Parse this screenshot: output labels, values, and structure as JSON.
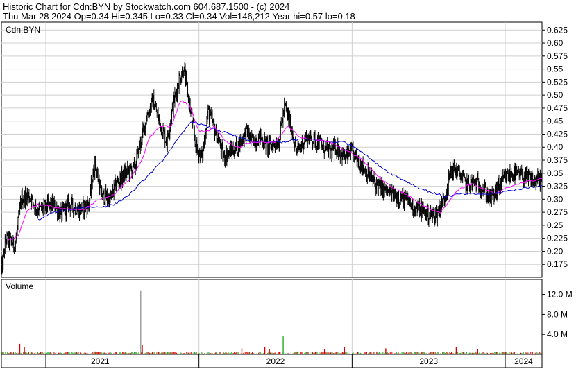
{
  "header": {
    "line1": "Historic Chart for Cdn:BYN by Stockwatch.com 604.687.1500 - (c) 2024",
    "line2": "Thu Mar 28 2024  Op=0.34  Hi=0.345  Lo=0.33  Cl=0.34  Vol=146,212  Year hi=0.57  lo=0.18"
  },
  "colors": {
    "price": "#000000",
    "ma_short": "#ff00ff",
    "ma_long": "#0000cc",
    "vol_up": "#22aa22",
    "vol_down": "#dd0000",
    "vol_spike": "#999999",
    "grid": "#cfcfcf",
    "frame": "#000000"
  },
  "chart_data": [
    {
      "type": "line",
      "name": "price",
      "panel_label": "Cdn:BYN",
      "grid": true,
      "y_axis_side": "right",
      "ylim": [
        0.15,
        0.64
      ],
      "y_ticks": [
        "0.625",
        "0.60",
        "0.575",
        "0.55",
        "0.525",
        "0.50",
        "0.475",
        "0.45",
        "0.425",
        "0.40",
        "0.375",
        "0.35",
        "0.325",
        "0.30",
        "0.275",
        "0.25",
        "0.225",
        "0.20",
        "0.175"
      ],
      "x_labels": [
        "2021",
        "2022",
        "2023",
        "2024"
      ],
      "xlim": [
        2020.71,
        2024.24
      ],
      "year_boundaries": [
        2021.0,
        2022.0,
        2023.0,
        2024.0
      ],
      "price_anchors": [
        [
          2020.71,
          0.16
        ],
        [
          2020.74,
          0.225
        ],
        [
          2020.8,
          0.21
        ],
        [
          2020.84,
          0.3
        ],
        [
          2020.88,
          0.31
        ],
        [
          2020.95,
          0.28
        ],
        [
          2021.05,
          0.29
        ],
        [
          2021.1,
          0.27
        ],
        [
          2021.15,
          0.29
        ],
        [
          2021.22,
          0.28
        ],
        [
          2021.28,
          0.29
        ],
        [
          2021.32,
          0.37
        ],
        [
          2021.36,
          0.31
        ],
        [
          2021.42,
          0.3
        ],
        [
          2021.46,
          0.33
        ],
        [
          2021.52,
          0.35
        ],
        [
          2021.58,
          0.36
        ],
        [
          2021.62,
          0.41
        ],
        [
          2021.66,
          0.46
        ],
        [
          2021.7,
          0.49
        ],
        [
          2021.74,
          0.45
        ],
        [
          2021.79,
          0.41
        ],
        [
          2021.83,
          0.48
        ],
        [
          2021.87,
          0.53
        ],
        [
          2021.9,
          0.55
        ],
        [
          2021.94,
          0.48
        ],
        [
          2021.98,
          0.4
        ],
        [
          2022.02,
          0.38
        ],
        [
          2022.06,
          0.47
        ],
        [
          2022.12,
          0.42
        ],
        [
          2022.16,
          0.38
        ],
        [
          2022.2,
          0.39
        ],
        [
          2022.25,
          0.4
        ],
        [
          2022.31,
          0.43
        ],
        [
          2022.35,
          0.41
        ],
        [
          2022.4,
          0.42
        ],
        [
          2022.45,
          0.4
        ],
        [
          2022.52,
          0.41
        ],
        [
          2022.56,
          0.48
        ],
        [
          2022.6,
          0.44
        ],
        [
          2022.64,
          0.39
        ],
        [
          2022.7,
          0.42
        ],
        [
          2022.78,
          0.41
        ],
        [
          2022.85,
          0.39
        ],
        [
          2022.9,
          0.4
        ],
        [
          2022.95,
          0.38
        ],
        [
          2023.0,
          0.39
        ],
        [
          2023.05,
          0.37
        ],
        [
          2023.1,
          0.35
        ],
        [
          2023.15,
          0.33
        ],
        [
          2023.2,
          0.32
        ],
        [
          2023.25,
          0.31
        ],
        [
          2023.3,
          0.305
        ],
        [
          2023.35,
          0.3
        ],
        [
          2023.4,
          0.285
        ],
        [
          2023.45,
          0.28
        ],
        [
          2023.5,
          0.27
        ],
        [
          2023.55,
          0.27
        ],
        [
          2023.6,
          0.3
        ],
        [
          2023.65,
          0.36
        ],
        [
          2023.7,
          0.35
        ],
        [
          2023.74,
          0.33
        ],
        [
          2023.78,
          0.33
        ],
        [
          2023.82,
          0.33
        ],
        [
          2023.86,
          0.32
        ],
        [
          2023.9,
          0.3
        ],
        [
          2023.93,
          0.31
        ],
        [
          2023.97,
          0.33
        ],
        [
          2024.0,
          0.34
        ],
        [
          2024.05,
          0.35
        ],
        [
          2024.1,
          0.345
        ],
        [
          2024.15,
          0.34
        ],
        [
          2024.2,
          0.335
        ],
        [
          2024.24,
          0.34
        ]
      ],
      "ma_short_anchors": [
        [
          2020.75,
          0.22
        ],
        [
          2020.82,
          0.23
        ],
        [
          2020.88,
          0.28
        ],
        [
          2020.95,
          0.29
        ],
        [
          2021.05,
          0.285
        ],
        [
          2021.15,
          0.28
        ],
        [
          2021.25,
          0.28
        ],
        [
          2021.35,
          0.3
        ],
        [
          2021.45,
          0.31
        ],
        [
          2021.55,
          0.34
        ],
        [
          2021.62,
          0.37
        ],
        [
          2021.68,
          0.42
        ],
        [
          2021.75,
          0.44
        ],
        [
          2021.82,
          0.44
        ],
        [
          2021.88,
          0.49
        ],
        [
          2021.94,
          0.48
        ],
        [
          2022.0,
          0.43
        ],
        [
          2022.05,
          0.43
        ],
        [
          2022.1,
          0.44
        ],
        [
          2022.18,
          0.41
        ],
        [
          2022.26,
          0.4
        ],
        [
          2022.34,
          0.41
        ],
        [
          2022.42,
          0.41
        ],
        [
          2022.5,
          0.41
        ],
        [
          2022.58,
          0.44
        ],
        [
          2022.66,
          0.42
        ],
        [
          2022.74,
          0.415
        ],
        [
          2022.85,
          0.41
        ],
        [
          2022.95,
          0.395
        ],
        [
          2023.05,
          0.38
        ],
        [
          2023.15,
          0.35
        ],
        [
          2023.25,
          0.325
        ],
        [
          2023.35,
          0.31
        ],
        [
          2023.45,
          0.29
        ],
        [
          2023.52,
          0.28
        ],
        [
          2023.58,
          0.275
        ],
        [
          2023.64,
          0.3
        ],
        [
          2023.7,
          0.32
        ],
        [
          2023.78,
          0.33
        ],
        [
          2023.86,
          0.32
        ],
        [
          2023.94,
          0.31
        ],
        [
          2024.0,
          0.32
        ],
        [
          2024.08,
          0.33
        ],
        [
          2024.16,
          0.335
        ],
        [
          2024.24,
          0.34
        ]
      ],
      "ma_long_anchors": [
        [
          2020.95,
          0.26
        ],
        [
          2021.05,
          0.275
        ],
        [
          2021.15,
          0.28
        ],
        [
          2021.25,
          0.285
        ],
        [
          2021.35,
          0.285
        ],
        [
          2021.45,
          0.29
        ],
        [
          2021.55,
          0.31
        ],
        [
          2021.65,
          0.34
        ],
        [
          2021.75,
          0.37
        ],
        [
          2021.85,
          0.41
        ],
        [
          2021.95,
          0.45
        ],
        [
          2022.05,
          0.44
        ],
        [
          2022.15,
          0.43
        ],
        [
          2022.25,
          0.42
        ],
        [
          2022.35,
          0.41
        ],
        [
          2022.45,
          0.41
        ],
        [
          2022.55,
          0.41
        ],
        [
          2022.65,
          0.415
        ],
        [
          2022.75,
          0.415
        ],
        [
          2022.85,
          0.41
        ],
        [
          2022.95,
          0.41
        ],
        [
          2023.05,
          0.395
        ],
        [
          2023.15,
          0.37
        ],
        [
          2023.25,
          0.35
        ],
        [
          2023.35,
          0.335
        ],
        [
          2023.45,
          0.32
        ],
        [
          2023.55,
          0.31
        ],
        [
          2023.62,
          0.305
        ],
        [
          2023.7,
          0.31
        ],
        [
          2023.8,
          0.31
        ],
        [
          2023.9,
          0.31
        ],
        [
          2024.0,
          0.315
        ],
        [
          2024.1,
          0.32
        ],
        [
          2024.2,
          0.325
        ],
        [
          2024.24,
          0.325
        ]
      ]
    },
    {
      "type": "bar",
      "name": "volume",
      "panel_label": "Volume",
      "y_axis_side": "right",
      "ylim": [
        0,
        15
      ],
      "y_ticks": [
        "12.0 M",
        "8.0 M",
        "4.0 M"
      ],
      "y_tick_values": [
        12,
        8,
        4
      ],
      "typical_volume_m": 0.3,
      "spikes_m": [
        [
          2020.83,
          2.1
        ],
        [
          2020.86,
          1.5
        ],
        [
          2021.62,
          12.8
        ],
        [
          2021.63,
          1.8
        ],
        [
          2022.28,
          1.2
        ],
        [
          2022.43,
          1.5
        ],
        [
          2022.46,
          1.1
        ],
        [
          2022.55,
          3.6
        ],
        [
          2022.82,
          1.0
        ],
        [
          2022.95,
          1.4
        ],
        [
          2023.22,
          1.2
        ],
        [
          2023.68,
          1.5
        ],
        [
          2023.82,
          1.0
        ]
      ]
    }
  ]
}
